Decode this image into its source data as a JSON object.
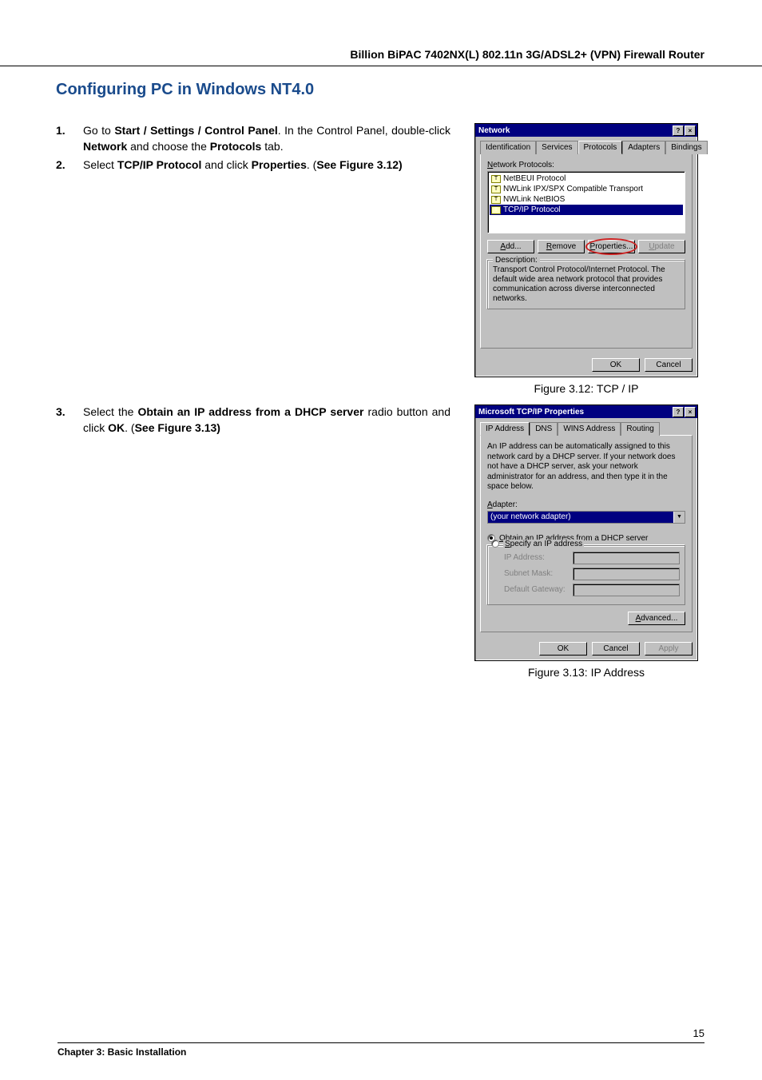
{
  "header": {
    "product_line": "Billion BiPAC 7402NX(L) 802.11n 3G/ADSL2+ (VPN) Firewall Router"
  },
  "title": "Configuring PC in Windows NT4.0",
  "steps": {
    "s1_num": "1.",
    "s1_a": "Go to ",
    "s1_b": "Start / Settings / Control Panel",
    "s1_c": ". In the Control Panel, double-click ",
    "s1_d": "Network",
    "s1_e": " and choose the ",
    "s1_f": "Protocols",
    "s1_g": " tab.",
    "s2_num": "2.",
    "s2_a": "Select ",
    "s2_b": "TCP/IP Protocol",
    "s2_c": " and click ",
    "s2_d": "Properties",
    "s2_e": ". (",
    "s2_f": "See Figure 3.12)",
    "s3_num": "3.",
    "s3_a": "Select the ",
    "s3_b": "Obtain an IP address from a DHCP server",
    "s3_c": " radio button and click ",
    "s3_d": "OK",
    "s3_e": ". (",
    "s3_f": "See Figure 3.13)"
  },
  "dlg1": {
    "title": "Network",
    "help_glyph": "?",
    "close_glyph": "×",
    "tabs": [
      "Identification",
      "Services",
      "Protocols",
      "Adapters",
      "Bindings"
    ],
    "list_label_u": "N",
    "list_label_rest": "etwork Protocols:",
    "items": [
      "NetBEUI Protocol",
      "NWLink IPX/SPX Compatible Transport",
      "NWLink NetBIOS",
      "TCP/IP Protocol"
    ],
    "btn_add_u": "A",
    "btn_add_rest": "dd...",
    "btn_remove_u": "R",
    "btn_remove_rest": "emove",
    "btn_props_u": "P",
    "btn_props_rest": "roperties...",
    "btn_update_u": "U",
    "btn_update_rest": "pdate",
    "desc_title": "Description:",
    "desc_text": "Transport Control Protocol/Internet Protocol. The default wide area network protocol that provides communication across diverse interconnected networks.",
    "ok": "OK",
    "cancel": "Cancel"
  },
  "caption1": "Figure 3.12: TCP / IP",
  "dlg2": {
    "title": "Microsoft TCP/IP Properties",
    "help_glyph": "?",
    "close_glyph": "×",
    "tabs": [
      "IP Address",
      "DNS",
      "WINS Address",
      "Routing"
    ],
    "info": "An IP address can be automatically assigned to this network card by a DHCP server. If your network does not have a DHCP server, ask your network administrator for an address, and then type it in the space below.",
    "adapter_label_u": "A",
    "adapter_label_rest": "dapter:",
    "adapter_value": "(your network adapter)",
    "radio_obtain_u": "O",
    "radio_obtain_rest": "btain an IP address from a DHCP server",
    "radio_specify_u": "S",
    "radio_specify_rest": "pecify an IP address",
    "ip_label": "IP Address:",
    "subnet_label": "Subnet Mask:",
    "gateway_label": "Default Gateway:",
    "advanced_u": "A",
    "advanced_rest": "dvanced...",
    "ok": "OK",
    "cancel": "Cancel",
    "apply": "Apply"
  },
  "caption2": "Figure 3.13: IP Address",
  "footer": {
    "page_num": "15",
    "chapter": "Chapter 3: Basic Installation"
  }
}
